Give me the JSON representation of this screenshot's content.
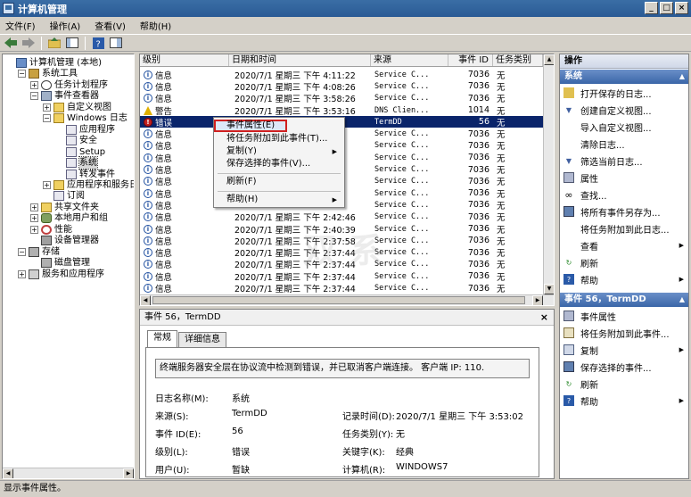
{
  "window": {
    "title": "计算机管理"
  },
  "menu": [
    "文件(F)",
    "操作(A)",
    "查看(V)",
    "帮助(H)"
  ],
  "tree": [
    {
      "label": "计算机管理 (本地)",
      "level": 0,
      "exp": "",
      "icon": "i-comp"
    },
    {
      "label": "系统工具",
      "level": 1,
      "exp": "−",
      "icon": "i-tool"
    },
    {
      "label": "任务计划程序",
      "level": 2,
      "exp": "+",
      "icon": "i-clock"
    },
    {
      "label": "事件查看器",
      "level": 2,
      "exp": "−",
      "icon": "i-event"
    },
    {
      "label": "自定义视图",
      "level": 3,
      "exp": "+",
      "icon": "i-folder"
    },
    {
      "label": "Windows 日志",
      "level": 3,
      "exp": "−",
      "icon": "i-folder"
    },
    {
      "label": "应用程序",
      "level": 4,
      "exp": "",
      "icon": "i-log"
    },
    {
      "label": "安全",
      "level": 4,
      "exp": "",
      "icon": "i-log"
    },
    {
      "label": "Setup",
      "level": 4,
      "exp": "",
      "icon": "i-log"
    },
    {
      "label": "系统",
      "level": 4,
      "exp": "",
      "icon": "i-log"
    },
    {
      "label": "转发事件",
      "level": 4,
      "exp": "",
      "icon": "i-log"
    },
    {
      "label": "应用程序和服务日志",
      "level": 3,
      "exp": "+",
      "icon": "i-folder"
    },
    {
      "label": "订阅",
      "level": 3,
      "exp": "",
      "icon": "i-log"
    },
    {
      "label": "共享文件夹",
      "level": 2,
      "exp": "+",
      "icon": "i-share"
    },
    {
      "label": "本地用户和组",
      "level": 2,
      "exp": "+",
      "icon": "i-user"
    },
    {
      "label": "性能",
      "level": 2,
      "exp": "+",
      "icon": "i-perf"
    },
    {
      "label": "设备管理器",
      "level": 2,
      "exp": "",
      "icon": "i-dev"
    },
    {
      "label": "存储",
      "level": 1,
      "exp": "−",
      "icon": "i-disk"
    },
    {
      "label": "磁盘管理",
      "level": 2,
      "exp": "",
      "icon": "i-disk"
    },
    {
      "label": "服务和应用程序",
      "level": 1,
      "exp": "+",
      "icon": "i-svc"
    }
  ],
  "list": {
    "columns": [
      "级别",
      "日期和时间",
      "来源",
      "事件 ID",
      "任务类别"
    ],
    "rows": [
      {
        "level": "信息",
        "type": "info",
        "date": "2020/7/1 星期三 下午 4:11:22",
        "source": "Service C...",
        "id": "7036",
        "cat": "无"
      },
      {
        "level": "信息",
        "type": "info",
        "date": "2020/7/1 星期三 下午 4:08:26",
        "source": "Service C...",
        "id": "7036",
        "cat": "无"
      },
      {
        "level": "信息",
        "type": "info",
        "date": "2020/7/1 星期三 下午 3:58:26",
        "source": "Service C...",
        "id": "7036",
        "cat": "无"
      },
      {
        "level": "警告",
        "type": "warn",
        "date": "2020/7/1 星期三 下午 3:53:16",
        "source": "DNS Clien...",
        "id": "1014",
        "cat": "无"
      },
      {
        "level": "错误",
        "type": "err",
        "date": "",
        "source": "TermDD",
        "id": "56",
        "cat": "无"
      },
      {
        "level": "信息",
        "type": "info",
        "date": "",
        "source": "Service C...",
        "id": "7036",
        "cat": "无"
      },
      {
        "level": "信息",
        "type": "info",
        "date": "",
        "source": "Service C...",
        "id": "7036",
        "cat": "无"
      },
      {
        "level": "信息",
        "type": "info",
        "date": "",
        "source": "Service C...",
        "id": "7036",
        "cat": "无"
      },
      {
        "level": "信息",
        "type": "info",
        "date": "",
        "source": "Service C...",
        "id": "7036",
        "cat": "无"
      },
      {
        "level": "信息",
        "type": "info",
        "date": "",
        "source": "Service C...",
        "id": "7036",
        "cat": "无"
      },
      {
        "level": "信息",
        "type": "info",
        "date": "",
        "source": "Service C...",
        "id": "7036",
        "cat": "无"
      },
      {
        "level": "信息",
        "type": "info",
        "date": "",
        "source": "Service C...",
        "id": "7036",
        "cat": "无"
      },
      {
        "level": "信息",
        "type": "info",
        "date": "2020/7/1 星期三 下午 2:42:46",
        "source": "Service C...",
        "id": "7036",
        "cat": "无"
      },
      {
        "level": "信息",
        "type": "info",
        "date": "2020/7/1 星期三 下午 2:40:39",
        "source": "Service C...",
        "id": "7036",
        "cat": "无"
      },
      {
        "level": "信息",
        "type": "info",
        "date": "2020/7/1 星期三 下午 2:37:58",
        "source": "Service C...",
        "id": "7036",
        "cat": "无"
      },
      {
        "level": "信息",
        "type": "info",
        "date": "2020/7/1 星期三 下午 2:37:44",
        "source": "Service C...",
        "id": "7036",
        "cat": "无"
      },
      {
        "level": "信息",
        "type": "info",
        "date": "2020/7/1 星期三 下午 2:37:44",
        "source": "Service C...",
        "id": "7036",
        "cat": "无"
      },
      {
        "level": "信息",
        "type": "info",
        "date": "2020/7/1 星期三 下午 2:37:44",
        "source": "Service C...",
        "id": "7036",
        "cat": "无"
      },
      {
        "level": "信息",
        "type": "info",
        "date": "2020/7/1 星期三 下午 2:37:44",
        "source": "Service C...",
        "id": "7036",
        "cat": "无"
      },
      {
        "level": "信息",
        "type": "info",
        "date": "",
        "source": "",
        "id": "",
        "cat": ""
      }
    ]
  },
  "context_menu": {
    "items": [
      "事件属性(E)",
      "将任务附加到此事件(T)...",
      "复制(Y)",
      "保存选择的事件(V)...",
      "刷新(F)",
      "帮助(H)"
    ]
  },
  "detail": {
    "header": "事件 56，TermDD",
    "tabs": [
      "常规",
      "详细信息"
    ],
    "message": "终端服务器安全层在协议流中检测到错误，并已取消客户端连接。 客户端 IP: 110.",
    "fields": {
      "log_name_label": "日志名称(M):",
      "log_name": "系统",
      "source_label": "来源(S):",
      "source": "TermDD",
      "logged_label": "记录时间(D):",
      "logged": "2020/7/1 星期三 下午 3:53:02",
      "event_id_label": "事件 ID(E):",
      "event_id": "56",
      "task_label": "任务类别(Y):",
      "task": "无",
      "level_label": "级别(L):",
      "level": "错误",
      "keywords_label": "关键字(K):",
      "keywords": "经典",
      "user_label": "用户(U):",
      "user": "暂缺",
      "computer_label": "计算机(R):",
      "computer": "WINDOWS7"
    }
  },
  "actions": {
    "header": "操作",
    "section1": "系统",
    "items1": [
      "打开保存的日志...",
      "创建自定义视图...",
      "导入自定义视图...",
      "清除日志...",
      "筛选当前日志...",
      "属性",
      "查找...",
      "将所有事件另存为...",
      "将任务附加到此日志...",
      "查看",
      "刷新",
      "帮助"
    ],
    "section2": "事件 56，TermDD",
    "items2": [
      "事件属性",
      "将任务附加到此事件...",
      "复制",
      "保存选择的事件...",
      "刷新",
      "帮助"
    ]
  },
  "status": "显示事件属性。",
  "watermark": "双 系"
}
